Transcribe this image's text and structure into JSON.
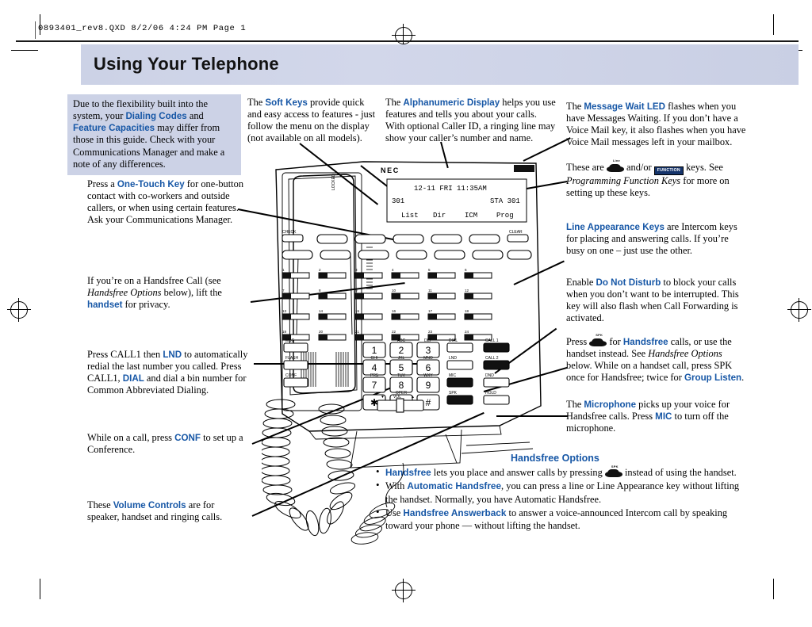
{
  "page": {
    "file_stamp": "0893401_rev8.QXD   8/2/06   4:24 PM   Page 1",
    "title": "Using Your Telephone"
  },
  "notes": {
    "flexibility": {
      "name": "flexibility-note",
      "html": "Due to the flexibility built into the system, your <b>Dialing Codes</b> and <b>Feature Capacities</b> may differ from those in this guide. Check with your Communications Manager and make a note of any differences."
    },
    "soft_keys": {
      "name": "soft-keys-note",
      "html": "The <b>Soft Keys</b> provide quick and easy access to features - just follow the menu on the display (not available on all models)."
    },
    "alphanumeric_display": {
      "name": "alphanumeric-display-note",
      "html": "The <b>Alphanumeric Display</b> helps you use features and tells you about your calls. With optional Caller ID, a ringing line may show your caller&rsquo;s number and name."
    },
    "message_wait_led": {
      "name": "message-wait-led-note",
      "html": "The <b>Message Wait LED</b> flashes when you have Messages Waiting. If you don&rsquo;t have a Voice Mail key, it also flashes when you have Voice Mail messages left in your mailbox."
    },
    "function_keys": {
      "name": "function-keys-note",
      "html": "These are <span class=\"spkglyph\"><span class=\"spklbl\">Line</span></span> and/or <span class=\"funcglyph\">FUNCTION</span> keys. See <i>Programming Function Keys</i> for more on setting up these keys."
    },
    "line_appearance": {
      "name": "line-appearance-note",
      "html": "<b>Line Appearance Keys</b> are Intercom keys for placing and answering calls. If you&rsquo;re busy on one &ndash; just use the other."
    },
    "do_not_disturb": {
      "name": "do-not-disturb-note",
      "html": "Enable <b>Do Not Disturb</b> to block your calls when you don&rsquo;t want to be interrupted. This key will also flash when Call Forwarding is activated."
    },
    "handsfree_press": {
      "name": "handsfree-press-note",
      "html": "Press <span class=\"spkglyph\"><span class=\"spklbl\">SPK</span></span> for <b>Handsfree</b> calls, or use the handset instead. See <i>Handsfree Options</i> below. While on a handset call, press SPK once for Handsfree; twice for <b>Group Listen</b>."
    },
    "microphone": {
      "name": "microphone-note",
      "html": "The <b>Microphone</b> picks up your voice for Handsfree calls. Press <b>MIC</b> to turn off the microphone."
    },
    "one_touch_key": {
      "name": "one-touch-key-note",
      "html": "Press a <b>One-Touch Key</b> for one-button contact with co-workers and outside callers, or when using certain features. Ask your Communications Manager."
    },
    "handset_privacy": {
      "name": "handset-privacy-note",
      "html": "If you&rsquo;re on a Handsfree Call (see <i>Handsfree Options</i> below), lift the <b>handset</b> for privacy."
    },
    "lnd_dial": {
      "name": "lnd-dial-note",
      "html": "Press CALL1 then <b>LND</b> to automatically redial the last number you called. Press CALL1, <b>DIAL</b> and dial a bin number for Common Abbreviated Dialing."
    },
    "conference": {
      "name": "conference-note",
      "html": "While on a call, press <b>CONF</b> to set up a Conference."
    },
    "volume_controls": {
      "name": "volume-controls-note",
      "html": "These <b>Volume Controls</b> are for speaker, handset and ringing calls."
    }
  },
  "handsfree_options": {
    "title": "Handsfree Options",
    "items": [
      "<b>Handsfree</b> lets you place and answer calls by pressing <span class=\"spkglyph\"><span class=\"spklbl\">SPK</span></span> instead of using the handset.",
      "With <b>Automatic Handsfree</b>, you can press a line or Line Appearance key without lifting the handset. Normally, you have Automatic Handsfree.",
      "Use <b>Handsfree Answerback</b> to answer a voice-announced Intercom call by speaking toward your phone &mdash; without lifting the handset."
    ]
  },
  "phone": {
    "brand": "NEC",
    "display": {
      "line1": "12-11 FRI 11:35AM",
      "line2_left": "301",
      "line2_right": "STA 301",
      "softkeys": [
        "List",
        "Dir",
        "ICM",
        "Prog"
      ]
    },
    "check_label": "CHECK",
    "clear_label": "CLEAR",
    "one_touch_keys": [
      "1",
      "2",
      "3",
      "4",
      "5",
      "6",
      "7",
      "8",
      "9",
      "10",
      "11",
      "12",
      "13",
      "14",
      "15",
      "16",
      "17",
      "18",
      "19",
      "20",
      "21",
      "22",
      "23",
      "24"
    ],
    "dialpad": [
      {
        "digit": "1",
        "letters": ""
      },
      {
        "digit": "2",
        "letters": "ABC"
      },
      {
        "digit": "3",
        "letters": "DEF"
      },
      {
        "digit": "4",
        "letters": "GHI"
      },
      {
        "digit": "5",
        "letters": "JKL"
      },
      {
        "digit": "6",
        "letters": "MNO"
      },
      {
        "digit": "7",
        "letters": "PRS"
      },
      {
        "digit": "8",
        "letters": "TUV"
      },
      {
        "digit": "9",
        "letters": "WXY"
      },
      {
        "digit": "✱",
        "letters": ""
      },
      {
        "digit": "0",
        "letters": "OPER"
      },
      {
        "digit": "#",
        "letters": ""
      }
    ],
    "left_function_keys": [
      "MSG",
      "FLASH",
      "CONF"
    ],
    "mid_function_keys": [
      "DIAL",
      "LND",
      "MIC",
      "SPK"
    ],
    "right_function_keys": [
      "CALL 1",
      "CALL 2",
      "DND",
      "HOLD"
    ],
    "volume_label": "VOL",
    "volume_down": "▼",
    "volume_up": "▲"
  },
  "colors": {
    "accent_blue": "#1757a6",
    "band": "#ccd2e6",
    "ink": "#000000"
  }
}
